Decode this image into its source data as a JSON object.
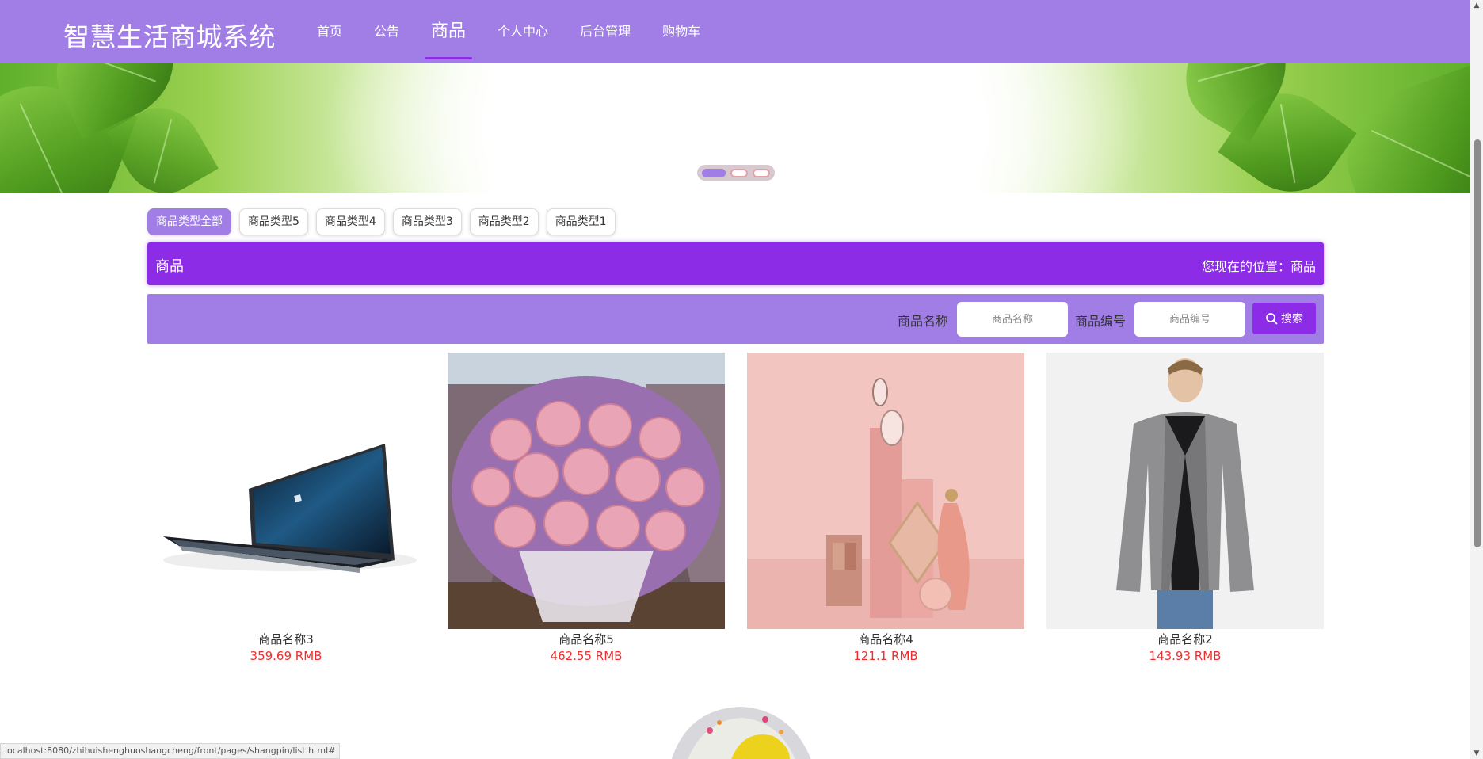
{
  "header": {
    "title": "智慧生活商城系统",
    "nav": [
      {
        "label": "首页",
        "active": false
      },
      {
        "label": "公告",
        "active": false
      },
      {
        "label": "商品",
        "active": true
      },
      {
        "label": "个人中心",
        "active": false
      },
      {
        "label": "后台管理",
        "active": false
      },
      {
        "label": "购物车",
        "active": false
      }
    ]
  },
  "banner": {
    "slides": 3,
    "active_slide": 1
  },
  "categories": [
    {
      "label": "商品类型全部",
      "active": true
    },
    {
      "label": "商品类型5",
      "active": false
    },
    {
      "label": "商品类型4",
      "active": false
    },
    {
      "label": "商品类型3",
      "active": false
    },
    {
      "label": "商品类型2",
      "active": false
    },
    {
      "label": "商品类型1",
      "active": false
    }
  ],
  "section": {
    "title": "商品",
    "location": "您现在的位置：商品"
  },
  "search": {
    "name_label": "商品名称",
    "name_placeholder": "商品名称",
    "code_label": "商品编号",
    "code_placeholder": "商品编号",
    "button_label": "搜索"
  },
  "products": [
    {
      "name": "商品名称3",
      "price": "359.69 RMB",
      "image": "laptop"
    },
    {
      "name": "商品名称5",
      "price": "462.55 RMB",
      "image": "rose-bouquet"
    },
    {
      "name": "商品名称4",
      "price": "121.1 RMB",
      "image": "cosmetics"
    },
    {
      "name": "商品名称2",
      "price": "143.93 RMB",
      "image": "jacket"
    }
  ],
  "status_url": "localhost:8080/zhihuishenghuoshangcheng/front/pages/shangpin/list.html#",
  "colors": {
    "header": "#a07ee6",
    "accent": "#8c2ce6",
    "price": "#ee2e2e"
  }
}
